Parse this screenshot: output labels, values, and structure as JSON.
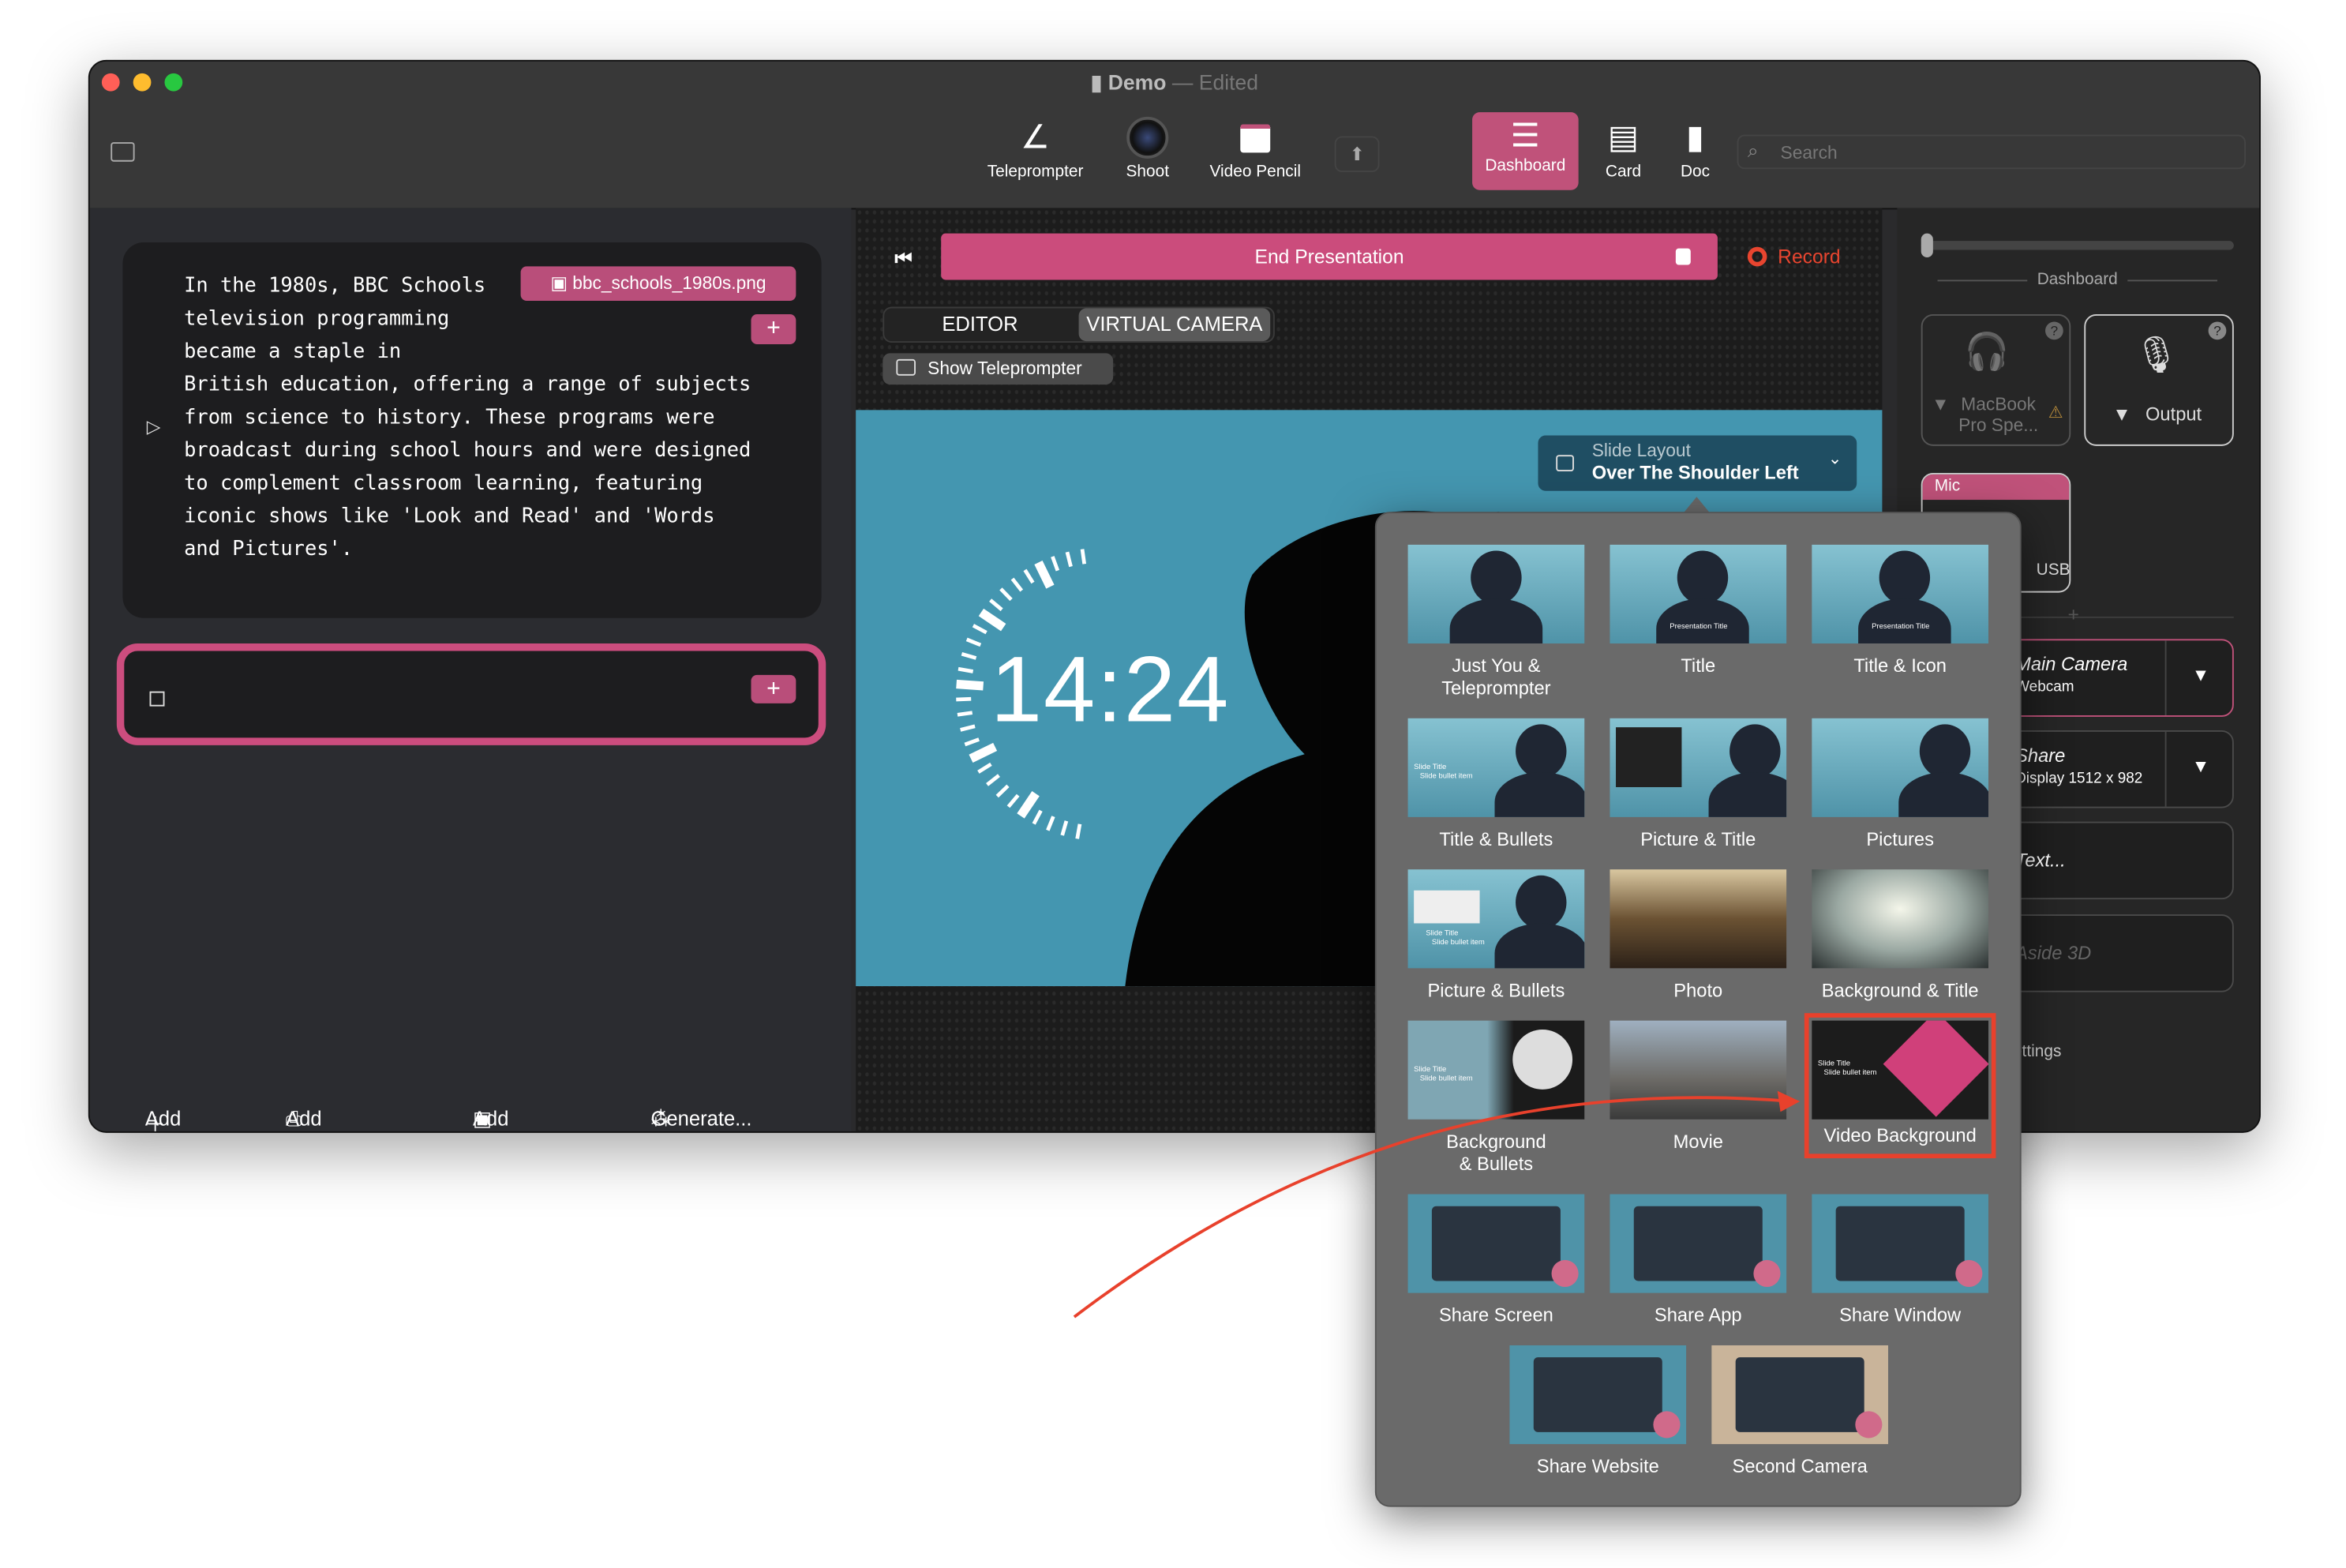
{
  "window": {
    "title": "Demo",
    "title_status": "Edited",
    "traffic_colors": [
      "#ff5f57",
      "#febc2e",
      "#28c840"
    ]
  },
  "toolbar": {
    "items": [
      {
        "label": "Teleprompter",
        "icon": "teleprompter-icon"
      },
      {
        "label": "Shoot",
        "icon": "camera-lens-icon"
      },
      {
        "label": "Video Pencil",
        "icon": "video-pencil-icon"
      }
    ],
    "views": [
      {
        "label": "Dashboard",
        "icon": "list-icon",
        "active": true
      },
      {
        "label": "Card",
        "icon": "card-icon"
      },
      {
        "label": "Doc",
        "icon": "doc-icon"
      }
    ],
    "search_placeholder": "Search",
    "accent": "#c0527a"
  },
  "left": {
    "card1": {
      "text": "In the 1980s, BBC Schools\ntelevision programming\nbecame a staple in\nBritish education, offering a range of subjects\nfrom science to history. These programs were\nbroadcast during school hours and were designed\nto complement classroom learning, featuring\niconic shows like 'Look and Read' and 'Words\nand Pictures'.",
      "attachment": "bbc_schools_1980s.png",
      "add": "+"
    },
    "card2": {
      "add": "+"
    },
    "bottom": {
      "add_card": "Add Card",
      "add_layout": "Add Layout...",
      "add_media": "Add Media...",
      "generate": "Generate..."
    }
  },
  "center": {
    "end_presentation": "End Presentation",
    "record": "Record",
    "record_color": "#e8452f",
    "tabs": [
      {
        "label": "EDITOR"
      },
      {
        "label": "VIRTUAL CAMERA",
        "active": true
      }
    ],
    "show_teleprompter": "Show Teleprompter",
    "clock": "14:24",
    "slide_layout": {
      "label": "Slide Layout",
      "value": "Over The Shoulder Left"
    }
  },
  "layouts": [
    {
      "label": "Just You &\nTeleprompter"
    },
    {
      "label": "Title"
    },
    {
      "label": "Title & Icon"
    },
    {
      "label": "Title & Bullets"
    },
    {
      "label": "Picture & Title"
    },
    {
      "label": "Pictures"
    },
    {
      "label": "Picture & Bullets"
    },
    {
      "label": "Photo"
    },
    {
      "label": "Background & Title"
    },
    {
      "label": "Background\n& Bullets"
    },
    {
      "label": "Movie"
    },
    {
      "label": "Video Background",
      "selected": true
    },
    {
      "label": "Share Screen"
    },
    {
      "label": "Share App"
    },
    {
      "label": "Share Window"
    },
    {
      "label": "Share Website"
    },
    {
      "label": "Second Camera"
    }
  ],
  "thumb_text": {
    "presentation_title": "Presentation Title",
    "slide_title": "Slide Title",
    "bullet": "Slide bullet item"
  },
  "right": {
    "section": "Dashboard",
    "audio_in": {
      "label": "MacBook\nPro Spe..."
    },
    "audio_out": {
      "label": "Output"
    },
    "mic": {
      "label": "Mic",
      "device": "USB"
    },
    "sources": [
      {
        "title": "Main Camera",
        "sub": "Webcam",
        "active": true
      },
      {
        "title": "Share",
        "sub": "Display 1512 x 982"
      },
      {
        "title": "Text..."
      },
      {
        "title": "Aside 3D",
        "dim": true
      }
    ],
    "settings": "Settings"
  },
  "highlight_color": "#e8412c"
}
